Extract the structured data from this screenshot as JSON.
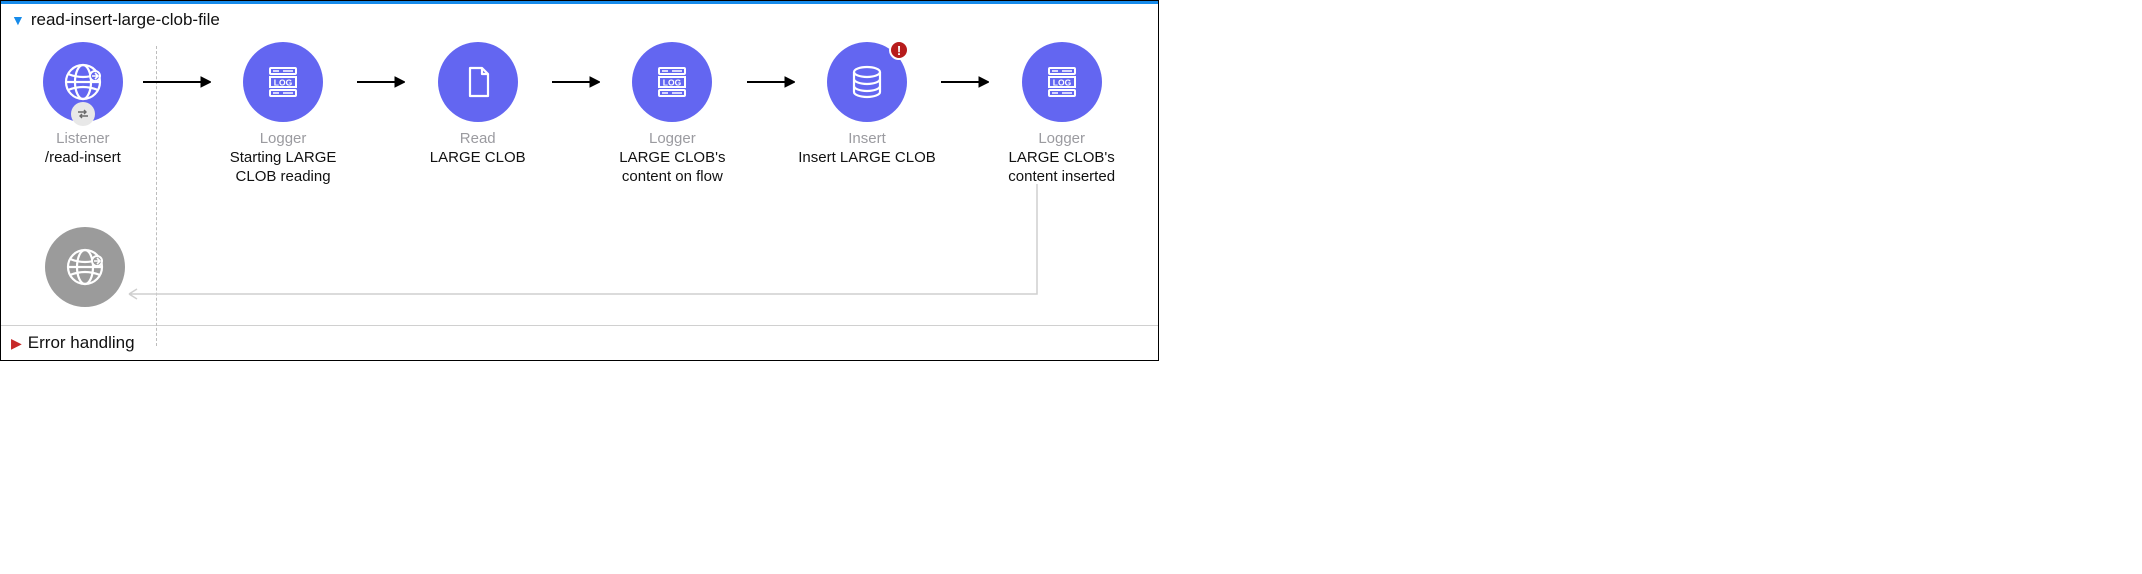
{
  "flow": {
    "title": "read-insert-large-clob-file",
    "error_section": "Error handling"
  },
  "nodes": {
    "listener": {
      "type": "Listener",
      "label": "/read-insert"
    },
    "logger1": {
      "type": "Logger",
      "label": "Starting LARGE CLOB reading"
    },
    "read": {
      "type": "Read",
      "label": "LARGE CLOB"
    },
    "logger2": {
      "type": "Logger",
      "label": "LARGE CLOB's content on flow"
    },
    "insert": {
      "type": "Insert",
      "label": "Insert LARGE CLOB"
    },
    "logger3": {
      "type": "Logger",
      "label": "LARGE CLOB's content inserted"
    }
  },
  "colors": {
    "node_primary": "#6366f1",
    "node_disabled": "#9b9b9b",
    "accent": "#178bea",
    "error_badge": "#b71c1c"
  }
}
